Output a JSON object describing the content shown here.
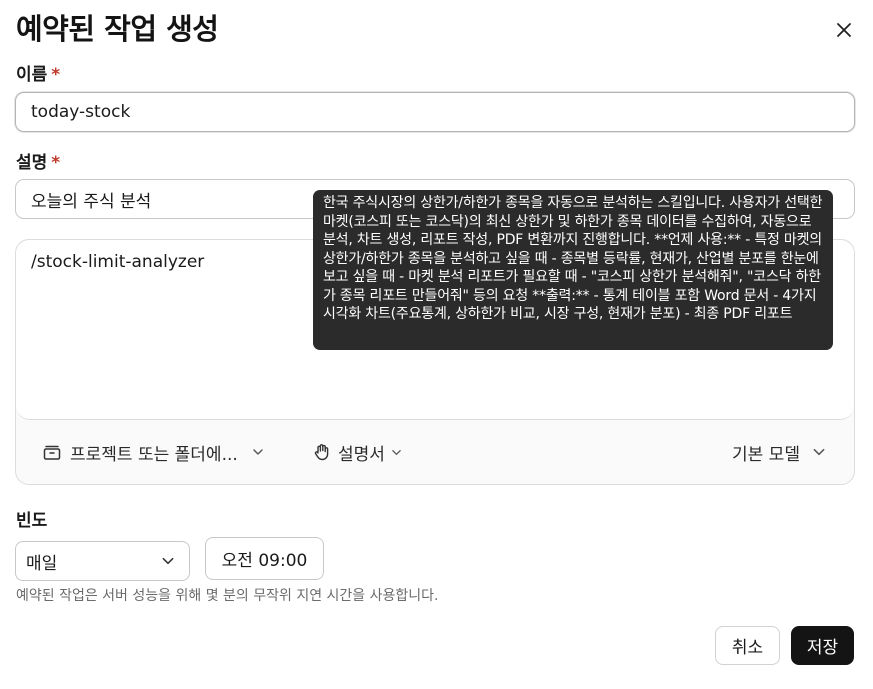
{
  "dialog": {
    "title": "예약된 작업 생성"
  },
  "name_field": {
    "label": "이름",
    "required_mark": "*",
    "value": "today-stock"
  },
  "description_field": {
    "label": "설명",
    "required_mark": "*",
    "value": "오늘의 주식 분석"
  },
  "prompt": {
    "value": "/stock-limit-analyzer"
  },
  "tooltip": {
    "text": "한국 주식시장의 상한가/하한가 종목을 자동으로 분석하는 스킬입니다. 사용자가 선택한 마켓(코스피 또는 코스닥)의 최신 상한가 및 하한가 종목 데이터를 수집하여, 자동으로 분석, 차트 생성, 리포트 작성, PDF 변환까지 진행합니다. **언제 사용:** - 특정 마켓의 상한가/하한가 종목을 분석하고 싶을 때 - 종목별 등락률, 현재가, 산업별 분포를 한눈에 보고 싶을 때 - 마켓 분석 리포트가 필요할 때 - \"코스피 상한가 분석해줘\", \"코스닥 하한가 종목 리포트 만들어줘\" 등의 요청 **출력:** - 통계 테이블 포함 Word 문서 - 4가지 시각화 차트(주요통계, 상하한가 비교, 시장 구성, 현재가 분포) - 최종 PDF 리포트"
  },
  "toolbar": {
    "project_label": "프로젝트 또는 폴더에...",
    "instructions_label": "설명서",
    "model_label": "기본 모델"
  },
  "frequency": {
    "label": "빈도",
    "selected": "매일",
    "time": "오전 09:00",
    "hint": "예약된 작업은 서버 성능을 위해 몇 분의 무작위 지연 시간을 사용합니다."
  },
  "actions": {
    "cancel_label": "취소",
    "save_label": "저장"
  },
  "colors": {
    "required": "#c0392b",
    "primary_button": "#141414",
    "tooltip_bg": "#2b2b2b"
  }
}
